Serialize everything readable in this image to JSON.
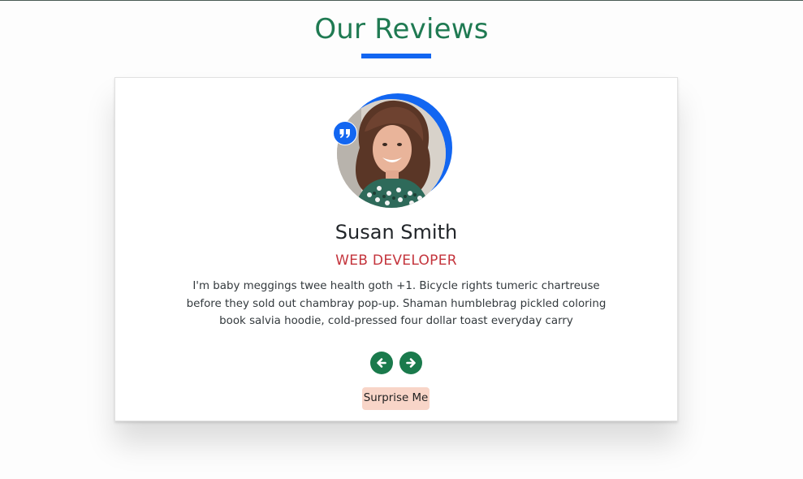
{
  "page": {
    "title": "Our Reviews"
  },
  "review": {
    "name": "Susan Smith",
    "job": "WEB DEVELOPER",
    "text": "I'm baby meggings twee health goth +1. Bicycle rights tumeric chartreuse before they sold out chambray pop-up. Shaman humblebrag pickled coloring book salvia hoodie, cold-pressed four dollar toast everyday carry"
  },
  "controls": {
    "surprise_label": "Surprise Me",
    "prev_icon": "chevron-left-circle-icon",
    "next_icon": "chevron-right-circle-icon",
    "quote_icon": "quote-icon"
  },
  "colors": {
    "title": "#1f7a52",
    "underline": "#1266f1",
    "job": "#c4343c",
    "nav": "#1a7a4c",
    "surprise_bg": "#f8d5c8"
  }
}
